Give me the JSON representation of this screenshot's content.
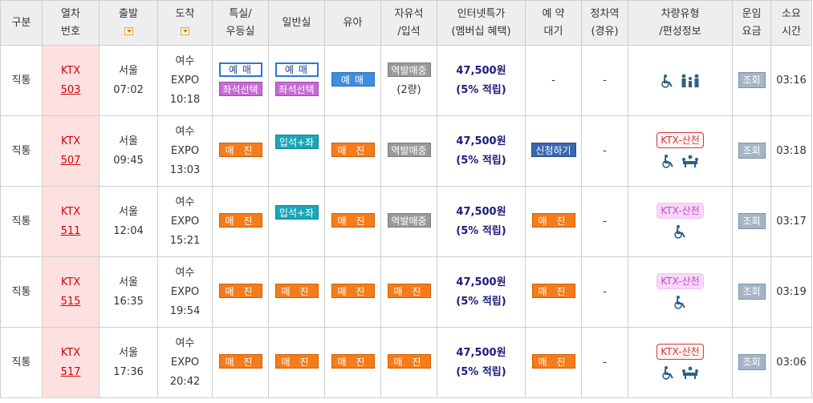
{
  "headers": {
    "type": "구분",
    "train_no": [
      "열차",
      "번호"
    ],
    "depart": "출발",
    "arrive": "도착",
    "special": [
      "특실/",
      "우등실"
    ],
    "general": "일반실",
    "infant": "유아",
    "free_seat": [
      "자유석",
      "/입석"
    ],
    "internet_price": [
      "인터넷특가",
      "(멤버십 혜택)"
    ],
    "reservation": [
      "예 약",
      "대기"
    ],
    "stops": [
      "정차역",
      "(경유)"
    ],
    "vehicle": [
      "차량유형",
      "/편성정보"
    ],
    "fare": [
      "운임",
      "요금"
    ],
    "duration": [
      "소요",
      "시간"
    ]
  },
  "rows": [
    {
      "type": "직통",
      "train_kind": "KTX",
      "train_no": "503",
      "dep_station": "서울",
      "dep_time": "07:02",
      "arr_station": [
        "여수",
        "EXPO"
      ],
      "arr_time": "10:18",
      "special": {
        "res": "예 매",
        "seat": "좌석선택"
      },
      "general": {
        "res": "예 매",
        "seat": "좌석선택"
      },
      "infant": "예 매",
      "free_seat": {
        "label": "역발매중",
        "note": "(2량)"
      },
      "price": "47,500원",
      "points": "(5% 적립)",
      "reservation": "-",
      "stops": "-",
      "vehicle_badge": "",
      "vehicle_icons": [
        "wheelchair-icon",
        "family-icon"
      ],
      "fare": "조회",
      "duration": "03:16"
    },
    {
      "type": "직통",
      "train_kind": "KTX",
      "train_no": "507",
      "dep_station": "서울",
      "dep_time": "09:45",
      "arr_station": [
        "여수",
        "EXPO"
      ],
      "arr_time": "13:03",
      "special": "매 진",
      "general": "입석+좌석",
      "infant": "매 진",
      "free_seat": {
        "label": "역발매중",
        "note": ""
      },
      "price": "47,500원",
      "points": "(5% 적립)",
      "reservation": "신청하기",
      "stops": "-",
      "vehicle_badge": "KTX-산천",
      "vehicle_icons": [
        "wheelchair-icon",
        "meeting-room-icon"
      ],
      "fare": "조회",
      "duration": "03:18"
    },
    {
      "type": "직통",
      "train_kind": "KTX",
      "train_no": "511",
      "dep_station": "서울",
      "dep_time": "12:04",
      "arr_station": [
        "여수",
        "EXPO"
      ],
      "arr_time": "15:21",
      "special": "매 진",
      "general": "입석+좌석",
      "infant": "매 진",
      "free_seat": {
        "label": "역발매중",
        "note": ""
      },
      "price": "47,500원",
      "points": "(5% 적립)",
      "reservation": "매 진",
      "stops": "-",
      "vehicle_badge": "KTX-산천",
      "vehicle_icons": [
        "wheelchair-icon"
      ],
      "fare": "조회",
      "duration": "03:17"
    },
    {
      "type": "직통",
      "train_kind": "KTX",
      "train_no": "515",
      "dep_station": "서울",
      "dep_time": "16:35",
      "arr_station": [
        "여수",
        "EXPO"
      ],
      "arr_time": "19:54",
      "special": "매 진",
      "general": "매 진",
      "infant": "매 진",
      "free_seat": {
        "label": "매 진",
        "note": ""
      },
      "price": "47,500원",
      "points": "(5% 적립)",
      "reservation": "매 진",
      "stops": "-",
      "vehicle_badge": "KTX-산천",
      "vehicle_icons": [
        "wheelchair-icon"
      ],
      "fare": "조회",
      "duration": "03:19"
    },
    {
      "type": "직통",
      "train_kind": "KTX",
      "train_no": "517",
      "dep_station": "서울",
      "dep_time": "17:36",
      "arr_station": [
        "여수",
        "EXPO"
      ],
      "arr_time": "20:42",
      "special": "매 진",
      "general": "매 진",
      "infant": "매 진",
      "free_seat": {
        "label": "매 진",
        "note": ""
      },
      "price": "47,500원",
      "points": "(5% 적립)",
      "reservation": "매 진",
      "stops": "-",
      "vehicle_badge": "KTX-산천",
      "vehicle_icons": [
        "wheelchair-icon",
        "meeting-room-icon"
      ],
      "fare": "조회",
      "duration": "03:06"
    }
  ],
  "colors": {
    "train_cell_bg": "#fde0e0",
    "train_text": "#d8000c",
    "price_text": "#1b1b7a",
    "sold_out": "#f47c1b",
    "reserve_blue": "#3d8ee0",
    "seat_select_purple": "#c76ad4",
    "station_only_gray": "#9a9a9a",
    "standing_teal": "#19a7b8"
  }
}
